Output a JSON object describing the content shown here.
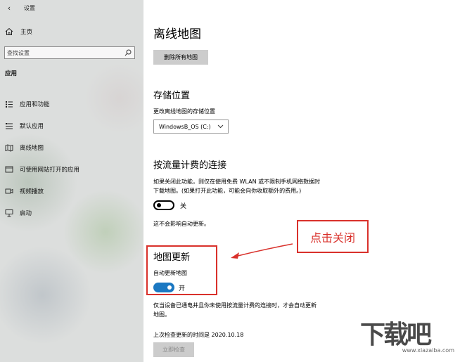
{
  "window": {
    "back_glyph": "‹",
    "app_title": "设置"
  },
  "sidebar": {
    "home_label": "主页",
    "search_placeholder": "查找设置",
    "section_title": "应用",
    "items": [
      {
        "label": "应用和功能",
        "icon": "apps-list-icon"
      },
      {
        "label": "默认应用",
        "icon": "default-apps-icon"
      },
      {
        "label": "离线地图",
        "icon": "offline-maps-icon"
      },
      {
        "label": "可使用网站打开的应用",
        "icon": "apps-for-websites-icon"
      },
      {
        "label": "视频播放",
        "icon": "video-playback-icon"
      },
      {
        "label": "启动",
        "icon": "startup-icon"
      }
    ]
  },
  "main": {
    "title": "离线地图",
    "delete_all_button": "删除所有地图",
    "storage": {
      "heading": "存储位置",
      "label": "更改离线地图的存储位置",
      "selected_drive": "WindowsB_OS (C:)"
    },
    "metered": {
      "heading": "按流量计费的连接",
      "description_line1": "如果关闭此功能，则仅在使用免费 WLAN 或不限制手机网络数据时",
      "description_line2": "下载地图。(如果打开此功能，可能会向你收取额外的费用。)",
      "toggle_state": "关",
      "note": "这不会影响自动更新。"
    },
    "updates": {
      "heading": "地图更新",
      "auto_update_label": "自动更新地图",
      "toggle_state": "开",
      "description_line1": "仅当设备已通电并且你未使用按流量计费的连接时，才会自动更新",
      "description_line2": "地图。",
      "last_checked": "上次检查更新的时间是 2020.10.18",
      "check_now_button": "立即检查"
    }
  },
  "annotation": {
    "callout_text": "点击关闭",
    "color": "#d9312b"
  },
  "watermark": {
    "logo_text": "下载吧",
    "sub_text": "www.xiazaiba.com"
  },
  "colors": {
    "toggle_on": "#1b78c2",
    "sidebar_bg": "#dcdedd",
    "button_bg": "#cccccc"
  }
}
